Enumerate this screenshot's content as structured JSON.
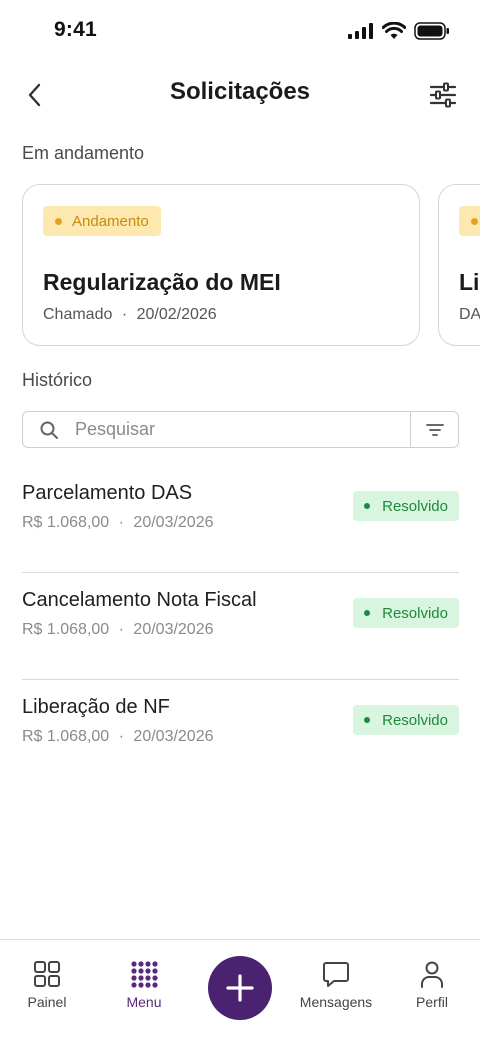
{
  "status_bar": {
    "time": "9:41"
  },
  "header": {
    "title": "Solicitações"
  },
  "sections": {
    "in_progress": "Em andamento",
    "history": "Histórico"
  },
  "cards": [
    {
      "badge": "Andamento",
      "title": "Regularização do MEI",
      "type": "Chamado",
      "date": "20/02/2026"
    },
    {
      "badge": "",
      "title": "Lil",
      "type": "DA",
      "date": ""
    }
  ],
  "search": {
    "placeholder": "Pesquisar",
    "value": ""
  },
  "history": [
    {
      "title": "Parcelamento DAS",
      "amount": "R$ 1.068,00",
      "date": "20/03/2026",
      "status": "Resolvido"
    },
    {
      "title": "Cancelamento Nota Fiscal",
      "amount": "R$ 1.068,00",
      "date": "20/03/2026",
      "status": "Resolvido"
    },
    {
      "title": "Liberação de NF",
      "amount": "R$ 1.068,00",
      "date": "20/03/2026",
      "status": "Resolvido"
    }
  ],
  "meta_separator": "·",
  "nav": {
    "painel": "Painel",
    "menu": "Menu",
    "mensagens": "Mensagens",
    "perfil": "Perfil",
    "active": "menu"
  },
  "colors": {
    "brand": "#4b2270",
    "badge_pending_bg": "#fde9b0",
    "badge_pending_text": "#c98a0b",
    "badge_resolved_bg": "#d8f5df",
    "badge_resolved_text": "#1f8a3a"
  },
  "icons": [
    "back-arrow-icon",
    "sliders-icon",
    "search-icon",
    "filter-icon",
    "grid-icon",
    "dots-grid-icon",
    "plus-icon",
    "chat-icon",
    "user-icon"
  ]
}
